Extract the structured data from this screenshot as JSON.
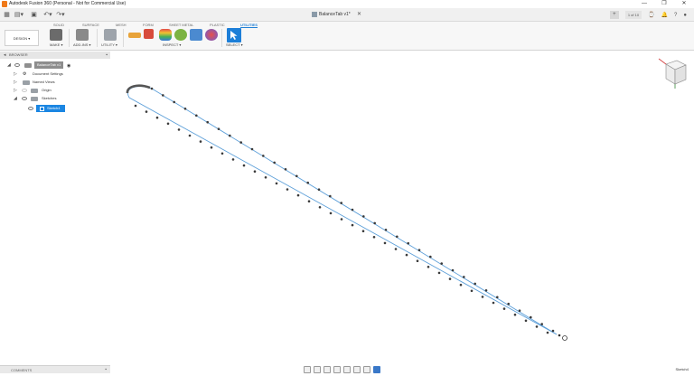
{
  "window": {
    "title": "Autodesk Fusion 360 (Personal - Not for Commercial Use)",
    "controls": [
      "—",
      "❐",
      "✕"
    ]
  },
  "toolbar": {
    "document_title": "BalanceTab v1*",
    "close_doc": "✕",
    "page_counter": "1 of 10",
    "right_icons": [
      "⌚",
      "🔔",
      "?",
      "●"
    ]
  },
  "ribbon": {
    "tabs": [
      "SOLID",
      "SURFACE",
      "MESH",
      "FORM",
      "SHEET METAL",
      "PLASTIC",
      "UTILITIES"
    ],
    "active_tab": "UTILITIES",
    "workspace": "DESIGN ▾",
    "groups": {
      "make": "MAKE ▾",
      "addins": "ADD-INS ▾",
      "utility": "UTILITY ▾",
      "inspect": "INSPECT ▾",
      "select": "SELECT ▾"
    },
    "colors": {
      "accent": "#1f7fd6"
    }
  },
  "browser": {
    "header": "BROWSER",
    "items": [
      {
        "label": "BalanceTab v1",
        "level": 0
      },
      {
        "label": "Document Settings",
        "level": 1
      },
      {
        "label": "Named Views",
        "level": 1
      },
      {
        "label": "Origin",
        "level": 1
      },
      {
        "label": "Sketches",
        "level": 1
      },
      {
        "label": "Sketch4",
        "level": 2
      }
    ]
  },
  "comments": {
    "label": "COMMENTS"
  },
  "status": {
    "active_sketch": "Sketch4"
  },
  "viewcube": {
    "top": "TOP",
    "front": "FRONT",
    "right": "RIGHT"
  }
}
